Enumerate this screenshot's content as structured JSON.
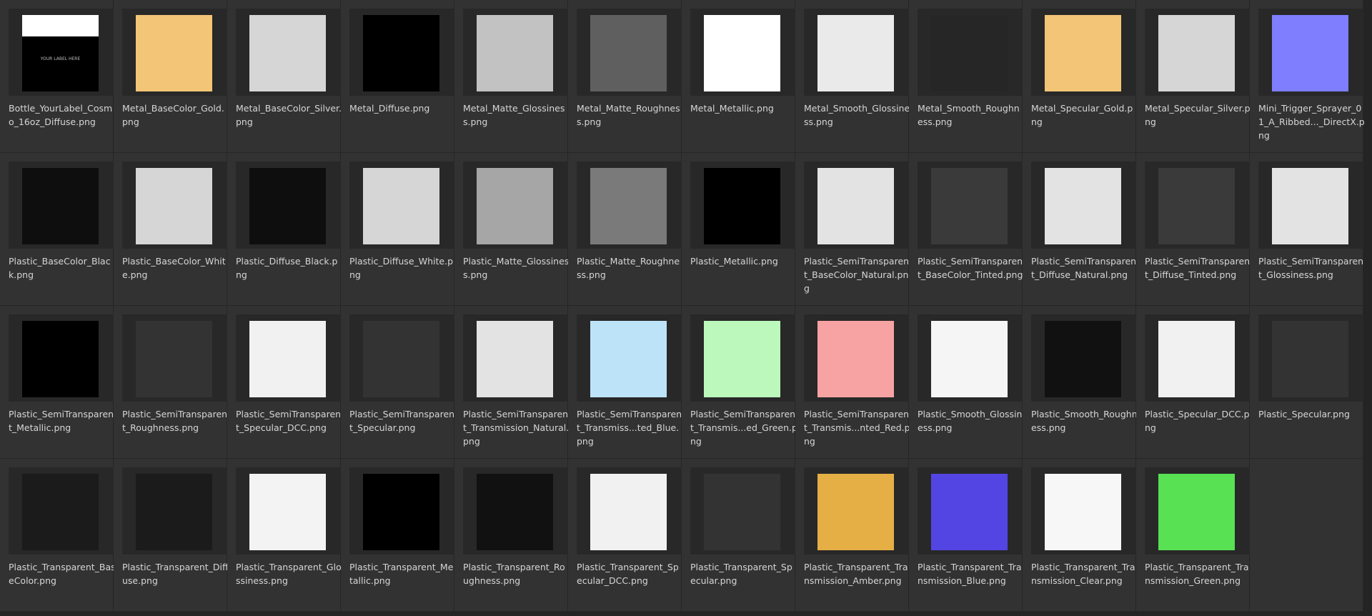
{
  "tiles": [
    {
      "name": "Bottle_YourLabel_Cosmo_16oz_Diffuse.png",
      "color": "#000000",
      "preview": "bottle-label",
      "preview_text": "YOUR LABEL HERE"
    },
    {
      "name": "Metal_BaseColor_Gold.png",
      "color": "#f3c576"
    },
    {
      "name": "Metal_BaseColor_Silver.png",
      "color": "#d6d6d6"
    },
    {
      "name": "Metal_Diffuse.png",
      "color": "#000000"
    },
    {
      "name": "Metal_Matte_Glossiness.png",
      "color": "#c2c2c2"
    },
    {
      "name": "Metal_Matte_Roughness.png",
      "color": "#5f5f5f"
    },
    {
      "name": "Metal_Metallic.png",
      "color": "#ffffff"
    },
    {
      "name": "Metal_Smooth_Glossiness.png",
      "color": "#eaeaea"
    },
    {
      "name": "Metal_Smooth_Roughness.png",
      "color": "#262626"
    },
    {
      "name": "Metal_Specular_Gold.png",
      "color": "#f3c576"
    },
    {
      "name": "Metal_Specular_Silver.png",
      "color": "#d6d6d6"
    },
    {
      "name": "Mini_Trigger_Sprayer_01_A_Ribbed..._DirectX.png",
      "color": "#7e7eff"
    },
    {
      "name": "Plastic_BaseColor_Black.png",
      "color": "#0e0e0e"
    },
    {
      "name": "Plastic_BaseColor_White.png",
      "color": "#d6d6d6"
    },
    {
      "name": "Plastic_Diffuse_Black.png",
      "color": "#0e0e0e"
    },
    {
      "name": "Plastic_Diffuse_White.png",
      "color": "#d6d6d6"
    },
    {
      "name": "Plastic_Matte_Glossiness.png",
      "color": "#a6a6a6"
    },
    {
      "name": "Plastic_Matte_Roughness.png",
      "color": "#7a7a7a"
    },
    {
      "name": "Plastic_Metallic.png",
      "color": "#000000"
    },
    {
      "name": "Plastic_SemiTransparent_BaseColor_Natural.png",
      "color": "#e3e3e3"
    },
    {
      "name": "Plastic_SemiTransparent_BaseColor_Tinted.png",
      "color": "#3a3a3a"
    },
    {
      "name": "Plastic_SemiTransparent_Diffuse_Natural.png",
      "color": "#e3e3e3"
    },
    {
      "name": "Plastic_SemiTransparent_Diffuse_Tinted.png",
      "color": "#3a3a3a"
    },
    {
      "name": "Plastic_SemiTransparent_Glossiness.png",
      "color": "#e3e3e3"
    },
    {
      "name": "Plastic_SemiTransparent_Metallic.png",
      "color": "#000000"
    },
    {
      "name": "Plastic_SemiTransparent_Roughness.png",
      "color": "#333333"
    },
    {
      "name": "Plastic_SemiTransparent_Specular_DCC.png",
      "color": "#f1f1f1"
    },
    {
      "name": "Plastic_SemiTransparent_Specular.png",
      "color": "#333333"
    },
    {
      "name": "Plastic_SemiTransparent_Transmission_Natural.png",
      "color": "#e3e3e3"
    },
    {
      "name": "Plastic_SemiTransparent_Transmiss...ted_Blue.png",
      "color": "#bde3f9"
    },
    {
      "name": "Plastic_SemiTransparent_Transmis...ed_Green.png",
      "color": "#bcf8bc"
    },
    {
      "name": "Plastic_SemiTransparent_Transmis...nted_Red.png",
      "color": "#f8a3a3"
    },
    {
      "name": "Plastic_Smooth_Glossiness.png",
      "color": "#f5f5f5"
    },
    {
      "name": "Plastic_Smooth_Roughness.png",
      "color": "#111111"
    },
    {
      "name": "Plastic_Specular_DCC.png",
      "color": "#f1f1f1"
    },
    {
      "name": "Plastic_Specular.png",
      "color": "#333333"
    },
    {
      "name": "Plastic_Transparent_BaseColor.png",
      "color": "#1b1b1b"
    },
    {
      "name": "Plastic_Transparent_Diffuse.png",
      "color": "#1b1b1b"
    },
    {
      "name": "Plastic_Transparent_Glossiness.png",
      "color": "#f3f3f3"
    },
    {
      "name": "Plastic_Transparent_Metallic.png",
      "color": "#000000"
    },
    {
      "name": "Plastic_Transparent_Roughness.png",
      "color": "#111111"
    },
    {
      "name": "Plastic_Transparent_Specular_DCC.png",
      "color": "#f1f1f1"
    },
    {
      "name": "Plastic_Transparent_Specular.png",
      "color": "#333333"
    },
    {
      "name": "Plastic_Transparent_Transmission_Amber.png",
      "color": "#e5af45"
    },
    {
      "name": "Plastic_Transparent_Transmission_Blue.png",
      "color": "#5345e3"
    },
    {
      "name": "Plastic_Transparent_Transmission_Clear.png",
      "color": "#f7f7f7"
    },
    {
      "name": "Plastic_Transparent_Transmission_Green.png",
      "color": "#57e153"
    }
  ]
}
